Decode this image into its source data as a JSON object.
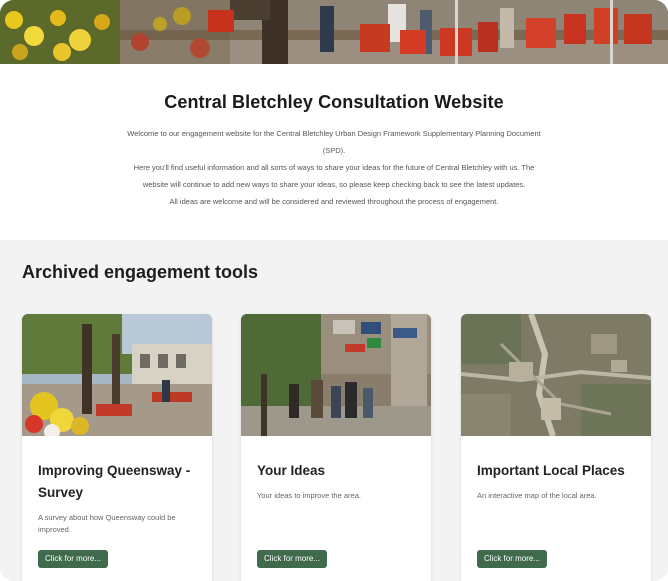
{
  "intro": {
    "title": "Central Bletchley Consultation Website",
    "lines": [
      "Welcome to our engagement website for the Central Bletchley Urban Design Framework Supplementary Planning Document",
      "(SPD).",
      "Here you'll find useful information and all sorts of ways to share your ideas for the future of Central Bletchley with us. The",
      "website will continue to add new ways to share your ideas, so please keep checking back to see the latest updates.",
      "All ideas are welcome and will be considered and reviewed throughout the process of engagement."
    ]
  },
  "archive": {
    "heading": "Archived engagement tools",
    "cards": [
      {
        "title": "Improving Queensway - Survey",
        "description": "A survey about how Queensway could be improved.",
        "button": "Click for more..."
      },
      {
        "title": "Your Ideas",
        "description": "Your ideas to improve the area.",
        "button": "Click for more..."
      },
      {
        "title": "Important Local Places",
        "description": "An interactive map of the local area.",
        "button": "Click for more..."
      }
    ]
  },
  "colors": {
    "button": "#3f6b4c",
    "section_bg": "#f3f3f3"
  }
}
